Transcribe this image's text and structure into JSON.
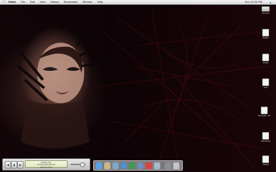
{
  "menubar": {
    "app_name": "Safari",
    "items": [
      "File",
      "Edit",
      "View",
      "History",
      "Bookmarks",
      "Window",
      "Help"
    ],
    "clock": "Sun 10:20 PM"
  },
  "desktop_icons": [
    {
      "label": "mill-lorem",
      "kind": "disk"
    },
    {
      "label": "Build01",
      "kind": "doc"
    },
    {
      "label": "Visuals",
      "kind": "doc"
    },
    {
      "label": "wxdir",
      "kind": "doc"
    },
    {
      "label": "New Audio - File",
      "kind": "doc"
    },
    {
      "label": "NakePhotos",
      "kind": "doc"
    },
    {
      "label": "Trashed",
      "kind": "doc"
    }
  ],
  "itunes": {
    "line1": "Moving Over",
    "line2": "Moving Swiss Miss (4)",
    "line3": "0:03:42 / 04:33"
  },
  "dock": {
    "items": [
      {
        "icon": "finder-icon",
        "color": "#5aa0e8"
      },
      {
        "icon": "address-book-icon",
        "color": "#c9b98a"
      },
      {
        "icon": "mail-icon",
        "color": "#7fa7c9"
      },
      {
        "icon": "safari-icon",
        "color": "#4b90d8"
      },
      {
        "icon": "ichat-icon",
        "color": "#3f9a4f"
      },
      {
        "icon": "itunes-icon",
        "color": "#6b8ec9"
      },
      {
        "icon": "ical-icon",
        "color": "#d9453c"
      },
      {
        "icon": "preview-icon",
        "color": "#a8b8c8"
      },
      {
        "icon": "system-prefs-icon",
        "color": "#8a8f96"
      },
      {
        "icon": "trash-icon",
        "color": "#c0c4c8"
      }
    ]
  }
}
